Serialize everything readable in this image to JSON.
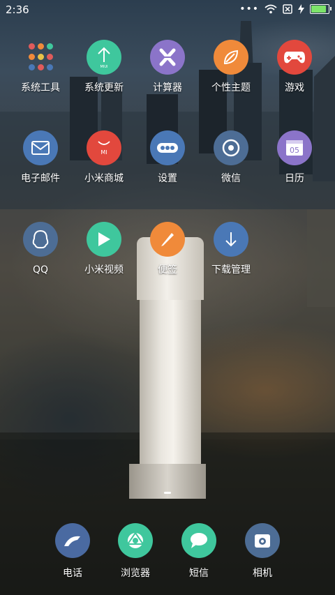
{
  "status_bar": {
    "time": "2:36",
    "icons": [
      "more-dots-icon",
      "wifi-icon",
      "no-sim-icon",
      "charging-icon",
      "battery-icon"
    ],
    "battery_color": "#7de36a"
  },
  "apps": [
    {
      "label": "系统工具",
      "icon": "folder-icon",
      "color": "transparent"
    },
    {
      "label": "系统更新",
      "icon": "update-arrow-icon",
      "color": "#3fc79d"
    },
    {
      "label": "计算器",
      "icon": "calculator-icon",
      "color": "#8b74c9"
    },
    {
      "label": "个性主题",
      "icon": "theme-leaf-icon",
      "color": "#f08a3a"
    },
    {
      "label": "游戏",
      "icon": "gamepad-icon",
      "color": "#e2483d"
    },
    {
      "label": "电子邮件",
      "icon": "envelope-icon",
      "color": "#4a78b6"
    },
    {
      "label": "小米商城",
      "icon": "mi-bag-icon",
      "color": "#e2483d"
    },
    {
      "label": "设置",
      "icon": "settings-icon",
      "color": "#4a78b6"
    },
    {
      "label": "微信",
      "icon": "chat-bubble-icon",
      "color": "#4d6d95"
    },
    {
      "label": "日历",
      "icon": "calendar-icon",
      "color": "#8b74c9",
      "calendar_day": "05"
    },
    {
      "label": "QQ",
      "icon": "penguin-icon",
      "color": "#4d6d95"
    },
    {
      "label": "小米视频",
      "icon": "play-icon",
      "color": "#3fc79d"
    },
    {
      "label": "便签",
      "icon": "pencil-icon",
      "color": "#f08a3a"
    },
    {
      "label": "下载管理",
      "icon": "download-icon",
      "color": "#4a78b6"
    }
  ],
  "update_icon_text": "MIUI",
  "mi_text": "MI",
  "dock": [
    {
      "label": "电话",
      "icon": "phone-icon",
      "color": "#4a6aa1"
    },
    {
      "label": "浏览器",
      "icon": "browser-icon",
      "color": "#3fc79d"
    },
    {
      "label": "短信",
      "icon": "message-icon",
      "color": "#3fc79d"
    },
    {
      "label": "相机",
      "icon": "camera-icon",
      "color": "#4d6d95"
    }
  ]
}
